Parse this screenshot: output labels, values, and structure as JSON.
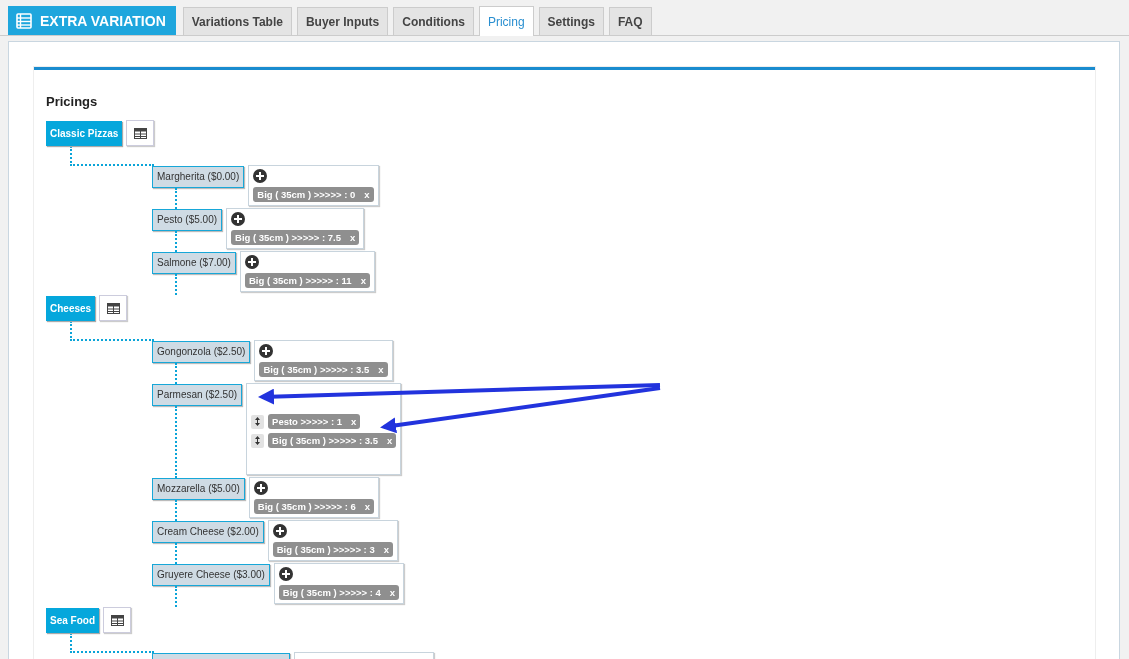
{
  "brand": {
    "title": "EXTRA VARIATION"
  },
  "tabs": [
    {
      "label": "Variations Table",
      "selected": false
    },
    {
      "label": "Buyer Inputs",
      "selected": false
    },
    {
      "label": "Conditions",
      "selected": false
    },
    {
      "label": "Pricing",
      "selected": true
    },
    {
      "label": "Settings",
      "selected": false
    },
    {
      "label": "FAQ",
      "selected": false
    }
  ],
  "section_title": "Pricings",
  "categories": [
    {
      "name": "Classic Pizzas",
      "items": [
        {
          "name": "Margherita ($0.00)",
          "kind": "add",
          "rules": [
            {
              "text": "Big ( 35cm ) >>>>> : 0",
              "remove": "x"
            }
          ]
        },
        {
          "name": "Pesto ($5.00)",
          "kind": "add",
          "rules": [
            {
              "text": "Big ( 35cm ) >>>>> : 7.5",
              "remove": "x"
            }
          ]
        },
        {
          "name": "Salmone ($7.00)",
          "kind": "add",
          "rules": [
            {
              "text": "Big ( 35cm ) >>>>> : 11",
              "remove": "x"
            }
          ]
        }
      ]
    },
    {
      "name": "Cheeses",
      "items": [
        {
          "name": "Gongonzola ($2.50)",
          "kind": "add",
          "rules": [
            {
              "text": "Big ( 35cm ) >>>>> : 3.5",
              "remove": "x"
            }
          ]
        },
        {
          "name": "Parmesan ($2.50)",
          "kind": "sort",
          "rules": [
            {
              "text": "Pesto >>>>> : 1",
              "remove": "x"
            },
            {
              "text": "Big ( 35cm ) >>>>> : 3.5",
              "remove": "x"
            }
          ]
        },
        {
          "name": "Mozzarella ($5.00)",
          "kind": "add",
          "rules": [
            {
              "text": "Big ( 35cm ) >>>>> : 6",
              "remove": "x"
            }
          ]
        },
        {
          "name": "Cream Cheese ($2.00)",
          "kind": "add",
          "rules": [
            {
              "text": "Big ( 35cm ) >>>>> : 3",
              "remove": "x"
            }
          ]
        },
        {
          "name": "Gruyere Cheese ($3.00)",
          "kind": "add",
          "rules": [
            {
              "text": "Big ( 35cm ) >>>>> : 4",
              "remove": "x"
            }
          ]
        }
      ]
    },
    {
      "name": "Sea Food",
      "more_below": true
    }
  ]
}
